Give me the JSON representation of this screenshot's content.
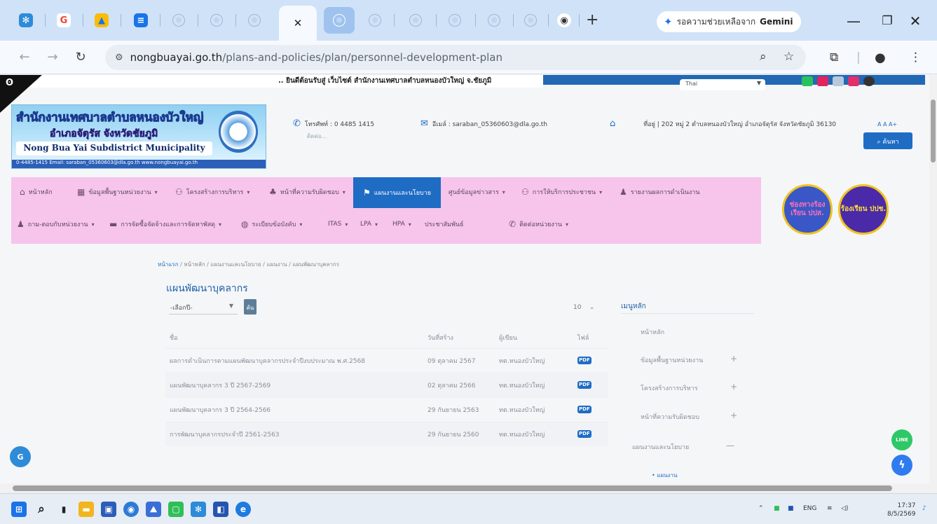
{
  "browser": {
    "active_tab_icon": "close-icon",
    "new_tab_label": "+",
    "gemini": {
      "prefix": "รอความช่วยเหลือจาก",
      "brand": "Gemini"
    },
    "url_host": "nongbuayai.go.th",
    "url_path": "/plans-and-policies/plan/personnel-development-plan"
  },
  "site": {
    "marquee": ".. ยินดีต้อนรับสู่ เว็บไซต์ สำนักงานเทศบาลตำบลหนองบัวใหญ่ จ.ชัยภูมิ",
    "lang": "Thai",
    "logo": {
      "title_th": "สำนักงานเทศบาลตำบลหนองบัวใหญ่",
      "subtitle_th": "อำเภอจัตุรัส จังหวัดชัยภูมิ",
      "name_en": "Nong Bua Yai Subdistrict Municipality",
      "contact": "0-4485-1415  Email: saraban_05360603@dla.go.th  www.nongbuayai.go.th"
    },
    "phone_label": "โทรศัพท์ : 0 4485 1415",
    "phone_sub": "ติดต่อ...",
    "email_label": "อีเมล์ : saraban_05360603@dla.go.th",
    "address_label": "ที่อยู่ | 202 หมู่ 2 ตำบลหนองบัวใหญ่ อำเภอจัตุรัส จังหวัดชัยภูมิ 36130",
    "font_sizes": "A  A  A+",
    "search_label": "ค้นหา"
  },
  "menu": {
    "items_row1": [
      "หน้าหลัก",
      "ข้อมูลพื้นฐานหน่วยงาน",
      "โครงสร้างการบริหาร",
      "หน้าที่ความรับผิดชอบ",
      "แผนงานและนโยบาย",
      "ศูนย์ข้อมูลข่าวสาร",
      "การให้บริการประชาชน",
      "รายงานผลการดำเนินงาน"
    ],
    "items_row2": [
      "ถาม-ตอบกับหน่วยงาน",
      "การจัดซื้อจัดจ้างและการจัดหาพัสดุ",
      "ระเบียบข้อบังคับ",
      "ITAS",
      "LPA",
      "HPA",
      "ประชาสัมพันธ์",
      "ติดต่อหน่วยงาน"
    ],
    "badges": [
      "ช่องทางร้องเรียน ปปส.",
      "ร้องเรียน ปปช."
    ]
  },
  "content": {
    "breadcrumb_home": "หน้าแรก",
    "breadcrumb": "หน้าหลัก / แผนงานและนโยบาย / แผนงาน / แผนพัฒนาบุคลากร",
    "title": "แผนพัฒนาบุคลากร",
    "filter_placeholder": "-เลือกปี-",
    "go_label": "ค้น",
    "per_page": "10",
    "columns": [
      "ชื่อ",
      "วันที่สร้าง",
      "ผู้เขียน",
      "ไฟล์"
    ],
    "rows": [
      {
        "name": "ผลการดำเนินการตามแผนพัฒนาบุคลากรประจำปีงบประมาณ พ.ศ.2568",
        "date": "09 ตุลาคม 2567",
        "author": "ทต.หนองบัวใหญ่",
        "file": "PDF"
      },
      {
        "name": "แผนพัฒนาบุคลากร 3 ปี 2567-2569",
        "date": "02 ตุลาคม 2566",
        "author": "ทต.หนองบัวใหญ่",
        "file": "PDF"
      },
      {
        "name": "แผนพัฒนาบุคลากร 3 ปี 2564-2566",
        "date": "29 กันยายน 2563",
        "author": "ทต.หนองบัวใหญ่",
        "file": "PDF"
      },
      {
        "name": "การพัฒนาบุคลากรประจำปี 2561-2563",
        "date": "29 กันยายน 2560",
        "author": "ทต.หนองบัวใหญ่",
        "file": "PDF"
      }
    ],
    "side_title": "เมนูหลัก",
    "side_items": [
      "หน้าหลัก",
      "ข้อมูลพื้นฐานหน่วยงาน",
      "โครงสร้างการบริหาร",
      "หน้าที่ความรับผิดชอบ",
      "แผนงานและนโยบาย"
    ],
    "side_sub": "แผนงาน",
    "line_label": "LINE"
  },
  "taskbar": {
    "lang": "ENG",
    "time": "17:37",
    "date": "8/5/2569"
  }
}
